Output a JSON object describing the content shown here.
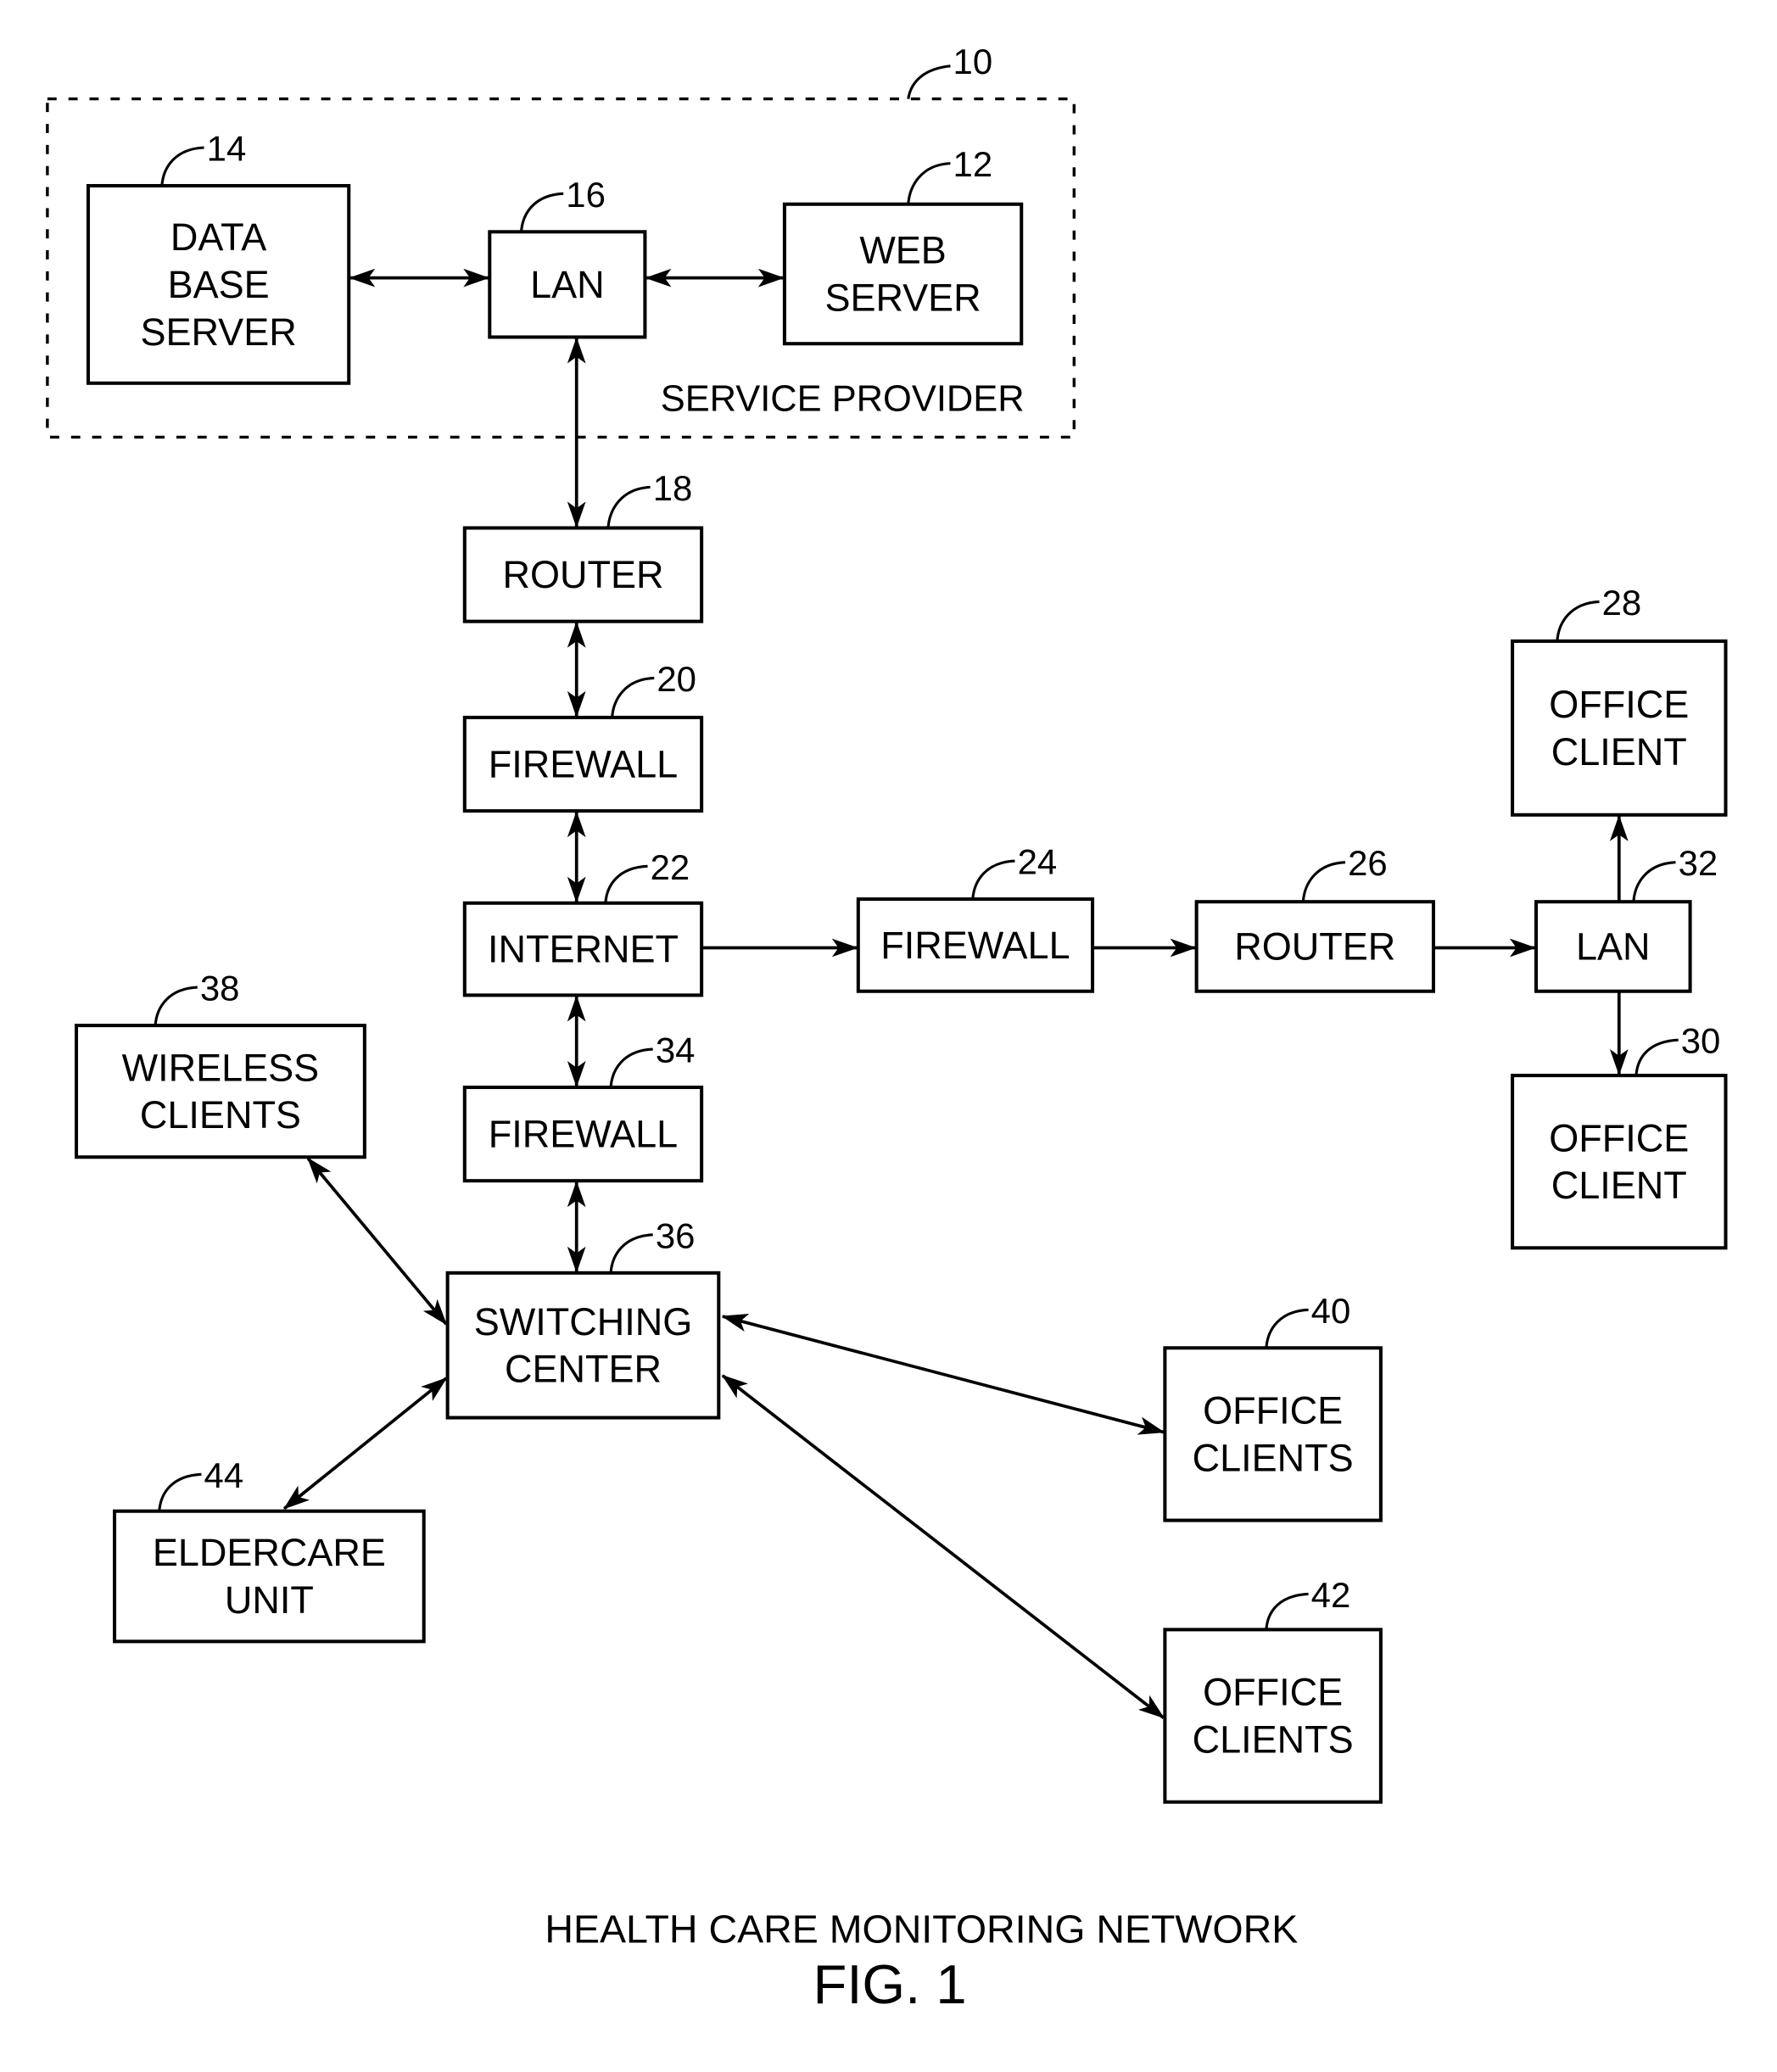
{
  "figure": {
    "caption": "HEALTH CARE MONITORING NETWORK",
    "figure_label": "FIG. 1"
  },
  "group": {
    "ref": "10",
    "label": "SERVICE PROVIDER"
  },
  "nodes": {
    "db_server": {
      "ref": "14",
      "lines": [
        "DATA",
        "BASE",
        "SERVER"
      ]
    },
    "lan16": {
      "ref": "16",
      "lines": [
        "LAN"
      ]
    },
    "web_server": {
      "ref": "12",
      "lines": [
        "WEB",
        "SERVER"
      ]
    },
    "router18": {
      "ref": "18",
      "lines": [
        "ROUTER"
      ]
    },
    "firewall20": {
      "ref": "20",
      "lines": [
        "FIREWALL"
      ]
    },
    "internet22": {
      "ref": "22",
      "lines": [
        "INTERNET"
      ]
    },
    "firewall24": {
      "ref": "24",
      "lines": [
        "FIREWALL"
      ]
    },
    "router26": {
      "ref": "26",
      "lines": [
        "ROUTER"
      ]
    },
    "lan32": {
      "ref": "32",
      "lines": [
        "LAN"
      ]
    },
    "office28": {
      "ref": "28",
      "lines": [
        "OFFICE",
        "CLIENT"
      ]
    },
    "office30": {
      "ref": "30",
      "lines": [
        "OFFICE",
        "CLIENT"
      ]
    },
    "firewall34": {
      "ref": "34",
      "lines": [
        "FIREWALL"
      ]
    },
    "switching36": {
      "ref": "36",
      "lines": [
        "SWITCHING",
        "CENTER"
      ]
    },
    "wireless38": {
      "ref": "38",
      "lines": [
        "WIRELESS",
        "CLIENTS"
      ]
    },
    "office40": {
      "ref": "40",
      "lines": [
        "OFFICE",
        "CLIENTS"
      ]
    },
    "office42": {
      "ref": "42",
      "lines": [
        "OFFICE",
        "CLIENTS"
      ]
    },
    "eldercare44": {
      "ref": "44",
      "lines": [
        "ELDERCARE",
        "UNIT"
      ]
    }
  },
  "connections": [
    {
      "from": "db_server",
      "to": "lan16",
      "direction": "bidirectional"
    },
    {
      "from": "lan16",
      "to": "web_server",
      "direction": "bidirectional"
    },
    {
      "from": "lan16",
      "to": "router18",
      "direction": "bidirectional"
    },
    {
      "from": "router18",
      "to": "firewall20",
      "direction": "bidirectional"
    },
    {
      "from": "firewall20",
      "to": "internet22",
      "direction": "bidirectional"
    },
    {
      "from": "internet22",
      "to": "firewall24",
      "direction": "forward"
    },
    {
      "from": "firewall24",
      "to": "router26",
      "direction": "forward"
    },
    {
      "from": "router26",
      "to": "lan32",
      "direction": "forward"
    },
    {
      "from": "lan32",
      "to": "office28",
      "direction": "forward"
    },
    {
      "from": "lan32",
      "to": "office30",
      "direction": "forward"
    },
    {
      "from": "internet22",
      "to": "firewall34",
      "direction": "bidirectional"
    },
    {
      "from": "firewall34",
      "to": "switching36",
      "direction": "bidirectional"
    },
    {
      "from": "wireless38",
      "to": "switching36",
      "direction": "bidirectional"
    },
    {
      "from": "eldercare44",
      "to": "switching36",
      "direction": "bidirectional"
    },
    {
      "from": "switching36",
      "to": "office40",
      "direction": "bidirectional"
    },
    {
      "from": "switching36",
      "to": "office42",
      "direction": "bidirectional"
    }
  ]
}
